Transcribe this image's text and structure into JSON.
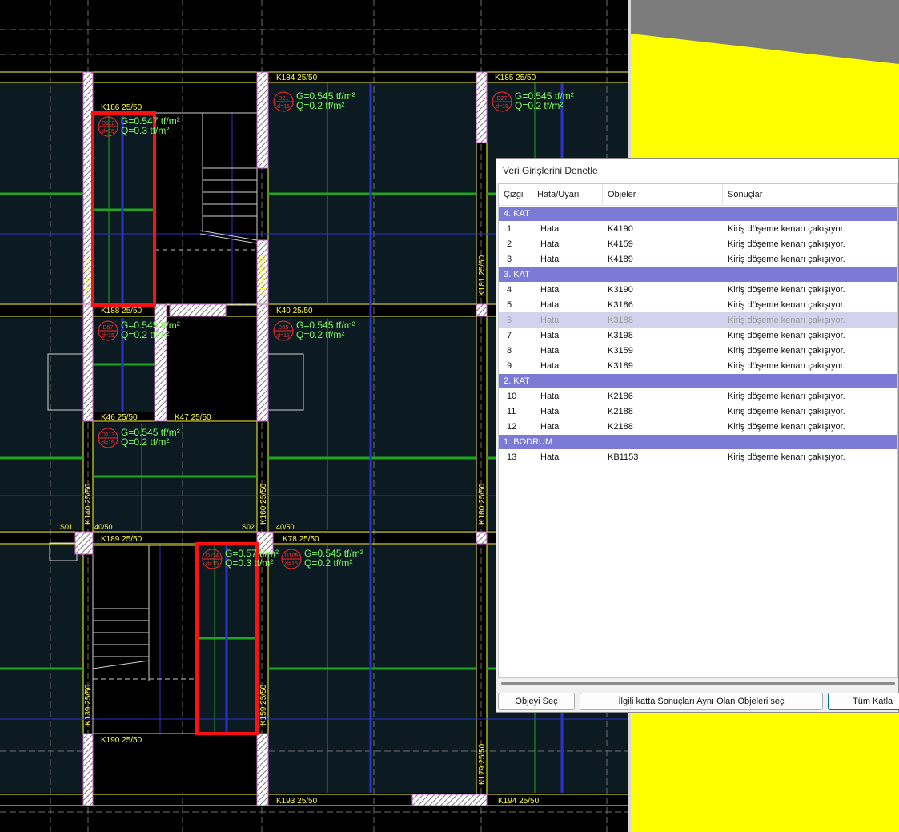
{
  "cad": {
    "beams": {
      "k184": "K184   25/50",
      "k185": "K185   25/50",
      "k186": "K186   25/50",
      "k188": "K188  25/50",
      "k40": "K40   25/50",
      "k46": "K46  25/50",
      "k47": "K47   25/50",
      "k189": "K189   25/50",
      "k78": "K78   25/50",
      "k190": "K190   25/50",
      "k193": "K193   25/50",
      "k194": "K194   25/50"
    },
    "columns": {
      "k198": "K198   25/50",
      "k199": "K199   25/50",
      "k181": "K181   25/50",
      "k140": "K140   25/50",
      "k160": "K160   25/50",
      "k180": "K180   25/50",
      "k139": "K139   25/50",
      "k159": "K159   25/50",
      "k179": "K179   25/50"
    },
    "supports": {
      "s01": "S01",
      "s02": "S02",
      "s01_size": "40/50",
      "s02_size": "40/50"
    },
    "slabs": [
      {
        "id": "D21",
        "thk": "d=15",
        "g": "G=0.545 tf/m²",
        "q": "Q=0.2 tf/m²"
      },
      {
        "id": "D27",
        "thk": "d=15",
        "g": "G=0.545 tf/m²",
        "q": "Q=0.2 tf/m²"
      },
      {
        "id": "D112",
        "thk": "d=15",
        "g": "G=0.547 tf/m²",
        "q": "Q=0.3  tf/m²"
      },
      {
        "id": "D57",
        "thk": "d=15",
        "g": "G=0.545 tf/m²",
        "q": "Q=0.2 tf/m²"
      },
      {
        "id": "D65",
        "thk": "d=15",
        "g": "G=0.545 tf/m²",
        "q": "Q=0.2 tf/m²"
      },
      {
        "id": "D113",
        "thk": "d=15",
        "g": "G=0.545 tf/m²",
        "q": "Q=0.2 tf/m²"
      },
      {
        "id": "D114",
        "thk": "d=15",
        "g": "G=0.57 tf/m²",
        "q": "Q=0.3  tf/m²"
      },
      {
        "id": "D105",
        "thk": "d=15",
        "g": "G=0.545 tf/m²",
        "q": "Q=0.2 tf/m²"
      }
    ]
  },
  "dialog": {
    "title": "Veri Girişlerini Denetle",
    "columns": [
      "Çizgi",
      "Hata/Uyarı",
      "Objeler",
      "Sonuçlar"
    ],
    "groups": [
      {
        "name": "4. KAT",
        "rows": [
          {
            "no": "1",
            "type": "Hata",
            "obj": "K4190",
            "result": "Kiriş döşeme kenarı çakışıyor."
          },
          {
            "no": "2",
            "type": "Hata",
            "obj": "K4159",
            "result": "Kiriş döşeme kenarı çakışıyor."
          },
          {
            "no": "3",
            "type": "Hata",
            "obj": "K4189",
            "result": "Kiriş döşeme kenarı çakışıyor."
          }
        ]
      },
      {
        "name": "3. KAT",
        "rows": [
          {
            "no": "4",
            "type": "Hata",
            "obj": "K3190",
            "result": "Kiriş döşeme kenarı çakışıyor."
          },
          {
            "no": "5",
            "type": "Hata",
            "obj": "K3186",
            "result": "Kiriş döşeme kenarı çakışıyor."
          },
          {
            "no": "6",
            "type": "Hata",
            "obj": "K3188",
            "result": "Kiriş döşeme kenarı çakışıyor.",
            "selected": true
          },
          {
            "no": "7",
            "type": "Hata",
            "obj": "K3198",
            "result": "Kiriş döşeme kenarı çakışıyor."
          },
          {
            "no": "8",
            "type": "Hata",
            "obj": "K3159",
            "result": "Kiriş döşeme kenarı çakışıyor."
          },
          {
            "no": "9",
            "type": "Hata",
            "obj": "K3189",
            "result": "Kiriş döşeme kenarı çakışıyor."
          }
        ]
      },
      {
        "name": "2. KAT",
        "rows": [
          {
            "no": "10",
            "type": "Hata",
            "obj": "K2186",
            "result": "Kiriş döşeme kenarı çakışıyor."
          },
          {
            "no": "11",
            "type": "Hata",
            "obj": "K2188",
            "result": "Kiriş döşeme kenarı çakışıyor."
          },
          {
            "no": "12",
            "type": "Hata",
            "obj": "K2188",
            "result": "Kiriş döşeme kenarı çakışıyor."
          }
        ]
      },
      {
        "name": "1. BODRUM",
        "rows": [
          {
            "no": "13",
            "type": "Hata",
            "obj": "KB1153",
            "result": "Kiriş döşeme kenarı çakışıyor."
          }
        ]
      }
    ],
    "buttons": {
      "select_object": "Objeyi Seç",
      "select_same": "İlgili katta Sonuçları Aynı Olan Objeleri seç",
      "all_floors": "Tüm Katla"
    }
  }
}
